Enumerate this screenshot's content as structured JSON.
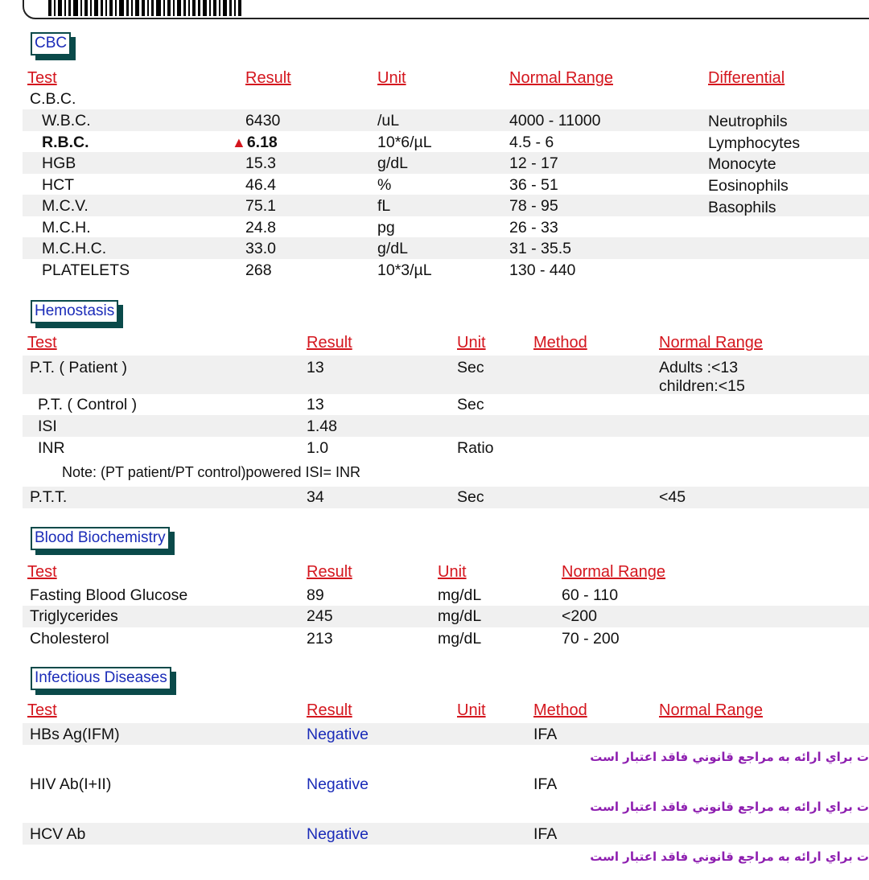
{
  "cbc": {
    "title": "CBC",
    "headers": {
      "test": "Test",
      "result": "Result",
      "unit": "Unit",
      "range": "Normal Range",
      "diff": "Differential"
    },
    "group": "C.B.C.",
    "rows": [
      {
        "test": "W.B.C.",
        "result": "6430",
        "unit": "/uL",
        "range": "4000 - 11000",
        "diff": "Neutrophils"
      },
      {
        "test": "R.B.C.",
        "result": "6.18",
        "unit": "10*6/µL",
        "range": "4.5 - 6",
        "diff": "Lymphocytes",
        "flag": "high"
      },
      {
        "test": "HGB",
        "result": "15.3",
        "unit": "g/dL",
        "range": "12 - 17",
        "diff": "Monocyte"
      },
      {
        "test": "HCT",
        "result": "46.4",
        "unit": "%",
        "range": "36 - 51",
        "diff": "Eosinophils"
      },
      {
        "test": "M.C.V.",
        "result": "75.1",
        "unit": "fL",
        "range": "78 - 95",
        "diff": "Basophils"
      },
      {
        "test": "M.C.H.",
        "result": "24.8",
        "unit": "pg",
        "range": "26 - 33",
        "diff": ""
      },
      {
        "test": "M.C.H.C.",
        "result": "33.0",
        "unit": "g/dL",
        "range": "31 - 35.5",
        "diff": ""
      },
      {
        "test": "PLATELETS",
        "result": "268",
        "unit": "10*3/µL",
        "range": "130 - 440",
        "diff": ""
      }
    ]
  },
  "hemostasis": {
    "title": "Hemostasis",
    "headers": {
      "test": "Test",
      "result": "Result",
      "unit": "Unit",
      "method": "Method",
      "range": "Normal Range"
    },
    "rows": [
      {
        "test": "P.T. ( Patient )",
        "result": "13",
        "unit": "Sec",
        "range": "Adults  :<13",
        "range2": "children:<15"
      },
      {
        "test": "P.T. ( Control )",
        "result": "13",
        "unit": "Sec"
      },
      {
        "test": "ISI",
        "result": "1.48",
        "unit": ""
      },
      {
        "test": "INR",
        "result": "1.0",
        "unit": "Ratio"
      },
      {
        "test": "P.T.T.",
        "result": "34",
        "unit": "Sec",
        "range": "<45"
      }
    ],
    "note": "Note:  (PT patient/PT control)powered ISI= INR"
  },
  "biochem": {
    "title": "Blood Biochemistry",
    "headers": {
      "test": "Test",
      "result": "Result",
      "unit": "Unit",
      "range": "Normal Range"
    },
    "rows": [
      {
        "test": "Fasting Blood Glucose",
        "result": "89",
        "unit": "mg/dL",
        "range": "60 - 110"
      },
      {
        "test": "Triglycerides",
        "result": "245",
        "unit": "mg/dL",
        "range": "<200"
      },
      {
        "test": "Cholesterol",
        "result": "213",
        "unit": "mg/dL",
        "range": "70 - 200"
      }
    ]
  },
  "infectious": {
    "title": "Infectious Diseases",
    "headers": {
      "test": "Test",
      "result": "Result",
      "unit": "Unit",
      "method": "Method",
      "range": "Normal Range"
    },
    "rows": [
      {
        "test": "HBs Ag(IFM)",
        "result": "Negative",
        "method": "IFA",
        "note": "ت براي ارائه به مراجع قانوني فاقد اعتبار است"
      },
      {
        "test": "HIV Ab(I+II)",
        "result": "Negative",
        "method": "IFA",
        "note": "ت براي ارائه به مراجع قانوني فاقد اعتبار است"
      },
      {
        "test": "HCV Ab",
        "result": "Negative",
        "method": "IFA",
        "note": "ت براي ارائه به مراجع قانوني فاقد اعتبار است"
      }
    ]
  }
}
